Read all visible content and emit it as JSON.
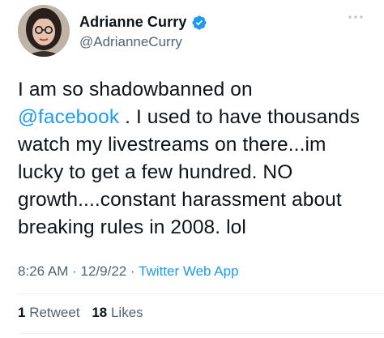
{
  "author": {
    "display_name": "Adrianne Curry",
    "handle": "@AdrianneCurry",
    "verified": true
  },
  "tweet": {
    "text_parts": [
      "I am so shadowbanned on\n",
      "@facebook",
      " . I used to have thousands watch my livestreams on there...im lucky to get a few hundred. NO growth....constant harassment about breaking rules in 2008. lol"
    ],
    "time": "8:26 AM",
    "date": "12/9/22",
    "separator": "·",
    "source": "Twitter Web App"
  },
  "stats": {
    "retweets_count": "1",
    "retweets_label": "Retweet",
    "likes_count": "18",
    "likes_label": "Likes"
  },
  "colors": {
    "link": "#1d9bf0",
    "secondary_text": "#536471",
    "primary_text": "#0f1419"
  },
  "icons": {
    "verified": "verified-badge-icon",
    "more": "more-options-icon"
  }
}
